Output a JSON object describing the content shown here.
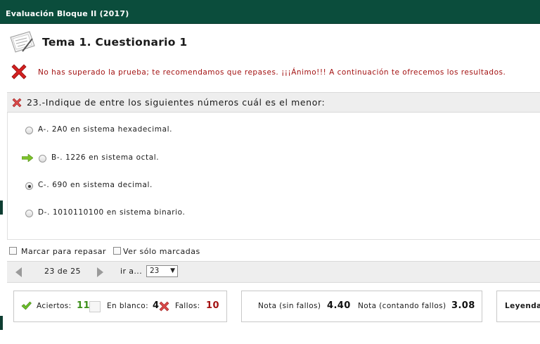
{
  "window": {
    "title": "Evaluación Bloque II (2017)"
  },
  "quiz": {
    "title": "Tema 1. Cuestionario 1",
    "result_message": "No has superado la prueba; te recomendamos que repases. ¡¡¡Ánimo!!! A continuación te ofrecemos los resultados."
  },
  "question": {
    "text": "23.-Indique de entre los siguientes números cuál es el menor:",
    "options": [
      {
        "label": "A-. 2A0 en sistema hexadecimal.",
        "selected": false,
        "correct": false
      },
      {
        "label": "B-. 1226 en sistema octal.",
        "selected": false,
        "correct": true
      },
      {
        "label": "C-. 690 en sistema decimal.",
        "selected": true,
        "correct": false
      },
      {
        "label": "D-. 1010110100 en sistema binario.",
        "selected": false,
        "correct": false
      }
    ]
  },
  "review": {
    "mark_label": "Marcar para repasar",
    "show_marked_label": "Ver sólo marcadas"
  },
  "navigation": {
    "page_indicator": "23 de 25",
    "goto_label": "ir a...",
    "goto_value": "23"
  },
  "stats": {
    "correct_label": "Aciertos:",
    "correct_value": "11",
    "blank_label": "En blanco:",
    "blank_value": "4",
    "wrong_label": "Fallos:",
    "wrong_value": "10",
    "grade_no_penalty_label": "Nota (sin fallos)",
    "grade_no_penalty_value": "4.40",
    "grade_penalty_label": "Nota (contando fallos)",
    "grade_penalty_value": "3.08",
    "legend_label": "Leyenda"
  },
  "colors": {
    "titlebar": "#0b4d3c",
    "error_text": "#a31212",
    "correct_green": "#3c8f1a"
  },
  "icons": [
    "quiz-sheet-icon",
    "fail-x-icon",
    "wrong-answer-icon",
    "correct-answer-arrow-icon",
    "check-icon",
    "blank-icon",
    "cross-icon",
    "prev-arrow-icon",
    "next-arrow-icon"
  ]
}
